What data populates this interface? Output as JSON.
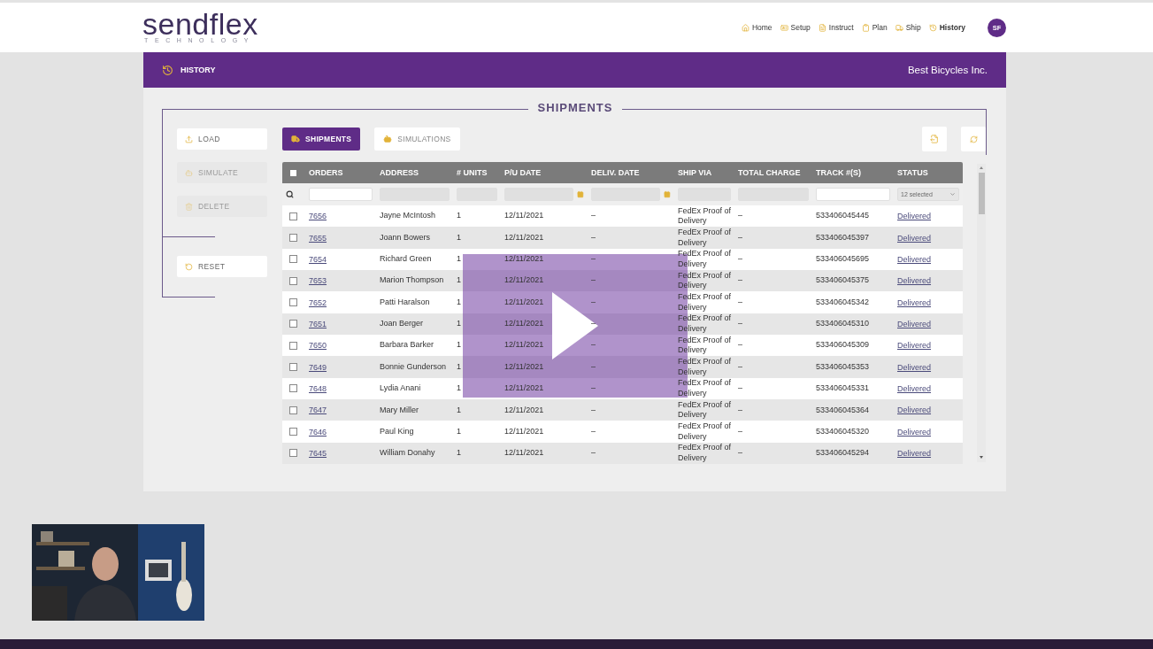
{
  "logo": {
    "name": "sendflex",
    "tagline": "TECHNOLOGY"
  },
  "nav": [
    {
      "label": "Home",
      "selected": false
    },
    {
      "label": "Setup",
      "selected": false
    },
    {
      "label": "Instruct",
      "selected": false
    },
    {
      "label": "Plan",
      "selected": false
    },
    {
      "label": "Ship",
      "selected": false
    },
    {
      "label": "History",
      "selected": true
    }
  ],
  "avatar": "SF",
  "banner": {
    "title": "HISTORY",
    "company": "Best Bicycles Inc."
  },
  "section_title": "SHIPMENTS",
  "side_actions": [
    {
      "label": "LOAD",
      "disabled": false
    },
    {
      "label": "SIMULATE",
      "disabled": true
    },
    {
      "label": "DELETE",
      "disabled": true
    }
  ],
  "reset_button": {
    "label": "RESET",
    "disabled": false
  },
  "view_tabs": [
    {
      "label": "SHIPMENTS",
      "selected": true
    },
    {
      "label": "SIMULATIONS",
      "selected": false
    }
  ],
  "table": {
    "select_all_checked": false,
    "columns": [
      {
        "label": "ORDERS",
        "kind": "text",
        "filter_disabled": false
      },
      {
        "label": "ADDRESS",
        "kind": "text",
        "filter_disabled": true
      },
      {
        "label": "# UNITS",
        "kind": "text",
        "filter_disabled": true
      },
      {
        "label": "P/U DATE",
        "kind": "date",
        "filter_disabled": true
      },
      {
        "label": "DELIV. DATE",
        "kind": "date",
        "filter_disabled": true
      },
      {
        "label": "SHIP VIA",
        "kind": "text",
        "filter_disabled": true
      },
      {
        "label": "TOTAL CHARGE",
        "kind": "text",
        "filter_disabled": true
      },
      {
        "label": "TRACK #(S)",
        "kind": "text",
        "filter_disabled": false
      },
      {
        "label": "STATUS",
        "kind": "select",
        "filter_disabled": true
      }
    ],
    "status_filter": "12 selected",
    "rows": [
      {
        "checked": false,
        "order": "7656",
        "address": "Jayne McIntosh",
        "units": "1",
        "pu_date": "12/11/2021",
        "deliv_date": "–",
        "ship_via": "FedEx Proof of Delivery",
        "total_charge": "–",
        "track": "533406045445",
        "status": "Delivered"
      },
      {
        "checked": false,
        "order": "7655",
        "address": "Joann Bowers",
        "units": "1",
        "pu_date": "12/11/2021",
        "deliv_date": "–",
        "ship_via": "FedEx Proof of Delivery",
        "total_charge": "–",
        "track": "533406045397",
        "status": "Delivered"
      },
      {
        "checked": false,
        "order": "7654",
        "address": "Richard Green",
        "units": "1",
        "pu_date": "12/11/2021",
        "deliv_date": "–",
        "ship_via": "FedEx Proof of Delivery",
        "total_charge": "–",
        "track": "533406045695",
        "status": "Delivered"
      },
      {
        "checked": false,
        "order": "7653",
        "address": "Marion Thompson",
        "units": "1",
        "pu_date": "12/11/2021",
        "deliv_date": "–",
        "ship_via": "FedEx Proof of Delivery",
        "total_charge": "–",
        "track": "533406045375",
        "status": "Delivered"
      },
      {
        "checked": false,
        "order": "7652",
        "address": "Patti Haralson",
        "units": "1",
        "pu_date": "12/11/2021",
        "deliv_date": "–",
        "ship_via": "FedEx Proof of Delivery",
        "total_charge": "–",
        "track": "533406045342",
        "status": "Delivered"
      },
      {
        "checked": false,
        "order": "7651",
        "address": "Joan Berger",
        "units": "1",
        "pu_date": "12/11/2021",
        "deliv_date": "–",
        "ship_via": "FedEx Proof of Delivery",
        "total_charge": "–",
        "track": "533406045310",
        "status": "Delivered"
      },
      {
        "checked": false,
        "order": "7650",
        "address": "Barbara Barker",
        "units": "1",
        "pu_date": "12/11/2021",
        "deliv_date": "–",
        "ship_via": "FedEx Proof of Delivery",
        "total_charge": "–",
        "track": "533406045309",
        "status": "Delivered"
      },
      {
        "checked": false,
        "order": "7649",
        "address": "Bonnie Gunderson",
        "units": "1",
        "pu_date": "12/11/2021",
        "deliv_date": "–",
        "ship_via": "FedEx Proof of Delivery",
        "total_charge": "–",
        "track": "533406045353",
        "status": "Delivered"
      },
      {
        "checked": false,
        "order": "7648",
        "address": "Lydia Anani",
        "units": "1",
        "pu_date": "12/11/2021",
        "deliv_date": "–",
        "ship_via": "FedEx Proof of Delivery",
        "total_charge": "–",
        "track": "533406045331",
        "status": "Delivered"
      },
      {
        "checked": false,
        "order": "7647",
        "address": "Mary Miller",
        "units": "1",
        "pu_date": "12/11/2021",
        "deliv_date": "–",
        "ship_via": "FedEx Proof of Delivery",
        "total_charge": "–",
        "track": "533406045364",
        "status": "Delivered"
      },
      {
        "checked": false,
        "order": "7646",
        "address": "Paul King",
        "units": "1",
        "pu_date": "12/11/2021",
        "deliv_date": "–",
        "ship_via": "FedEx Proof of Delivery",
        "total_charge": "–",
        "track": "533406045320",
        "status": "Delivered"
      },
      {
        "checked": false,
        "order": "7645",
        "address": "William Donahy",
        "units": "1",
        "pu_date": "12/11/2021",
        "deliv_date": "–",
        "ship_via": "FedEx Proof of Delivery",
        "total_charge": "–",
        "track": "533406045294",
        "status": "Delivered"
      }
    ]
  }
}
